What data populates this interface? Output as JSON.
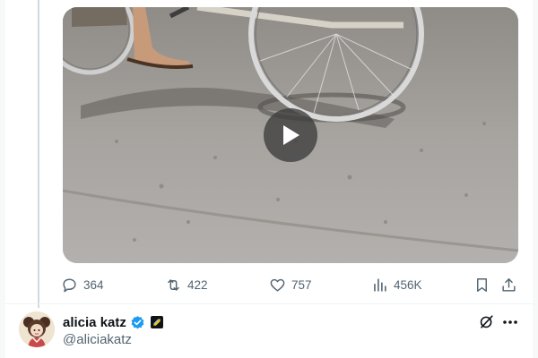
{
  "tweet": {
    "video": {
      "play_icon": "play-icon"
    },
    "actions": {
      "replies": "364",
      "reposts": "422",
      "likes": "757",
      "views": "456K",
      "icons": [
        "reply-icon",
        "repost-icon",
        "like-icon",
        "views-icon",
        "bookmark-icon",
        "share-icon"
      ]
    }
  },
  "next_tweet": {
    "display_name": "alicia katz",
    "handle": "@aliciakatz",
    "verified": true,
    "icons": [
      "verified-badge-icon",
      "affiliate-badge-icon",
      "grok-icon",
      "more-icon"
    ]
  },
  "colors": {
    "text_primary": "#0f1419",
    "text_secondary": "#536471",
    "verified_blue": "#1d9bf0",
    "thread_line": "#cfd9de",
    "affiliate_accent": "#f5c518"
  }
}
